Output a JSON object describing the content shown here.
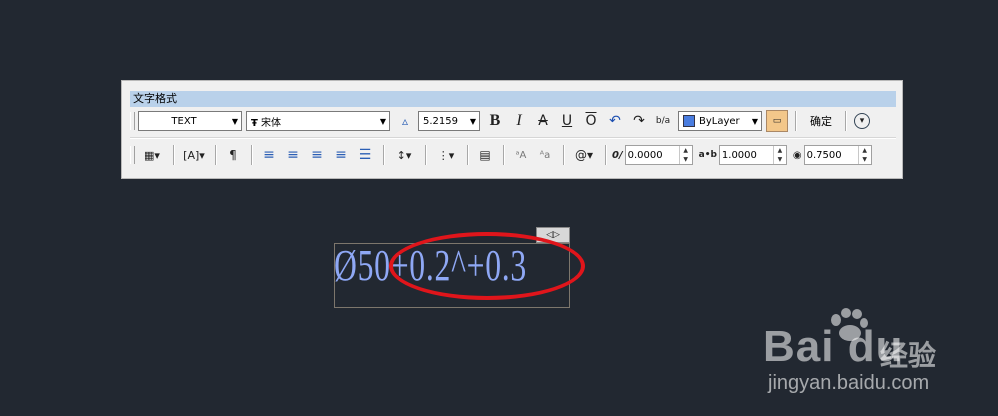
{
  "toolbar": {
    "title": "文字格式",
    "style_select": "TEXT",
    "font_select": "宋体",
    "font_icon": "Ŧ",
    "height_value": "5.2159",
    "bold": "B",
    "italic": "I",
    "strike": "A",
    "underline": "U",
    "overline": "O",
    "stack": "b/a",
    "color_select": "ByLayer",
    "ok_label": "确定",
    "oblique_value": "0.0000",
    "tracking_value": "1.0000",
    "width_value": "0.7500",
    "tracking_label": "a•b",
    "at_symbol": "@"
  },
  "editor": {
    "text": "Ø50+0.2^+0.3",
    "handle_label": "◁▷"
  },
  "watermark": {
    "logo": "Bai du",
    "cn": "经验",
    "url": "jingyan.baidu.com"
  },
  "colors": {
    "background": "#222831",
    "text": "#8fa8f5",
    "highlight": "#e0151b"
  }
}
